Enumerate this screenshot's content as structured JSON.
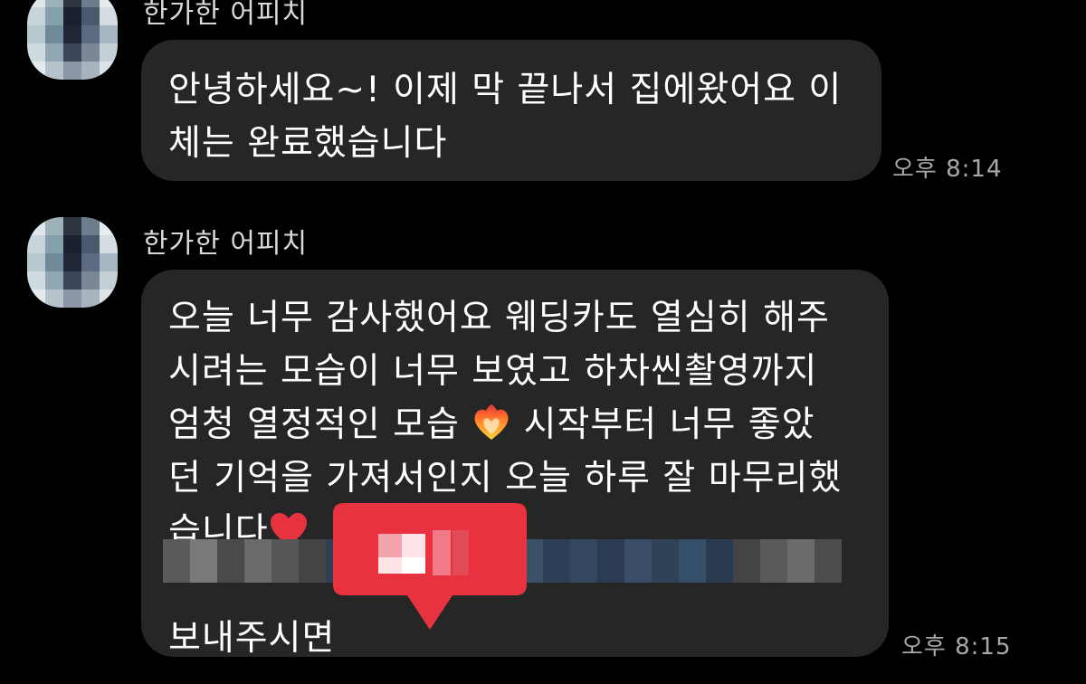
{
  "colors": {
    "background": "#000000",
    "bubble": "#262626",
    "sender_name": "#d9d9d9",
    "timestamp": "#a8a8a8",
    "reaction": "#e8323f"
  },
  "messages": [
    {
      "sender": "한가한 어피치",
      "lines": [
        "안녕하세요~! 이제 막 끝나서 집에왔어요 이",
        "체는 완료했습니다"
      ],
      "time": "오후 8:14"
    },
    {
      "sender": "한가한 어피치",
      "lines": [
        "오늘 너무 감사했어요 웨딩카도 열심히 해주",
        "시려는 모습이 너무 보였고 하차씬촬영까지",
        "엄청 열정적인 모습",
        "시작부터 너무 좋았",
        "던 기억을 가져서인지 오늘 하루 잘 마무리했",
        "습니다",
        "보내주시면"
      ],
      "time": "오후 8:15",
      "icons": [
        "heart-on-fire-icon",
        "red-heart-icon",
        "heart-reaction-icon"
      ]
    }
  ]
}
